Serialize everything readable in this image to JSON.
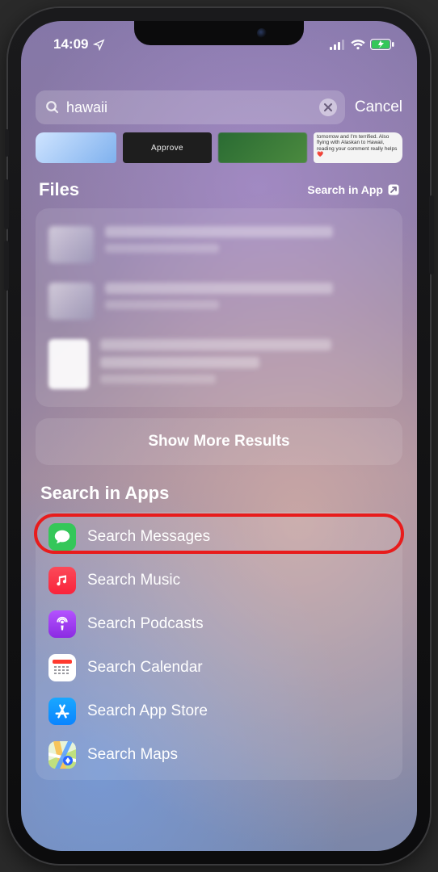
{
  "status": {
    "time": "14:09",
    "location_icon": "location-arrow"
  },
  "search": {
    "query": "hawaii",
    "cancel_label": "Cancel"
  },
  "suggestions": {
    "approve_label": "Approve",
    "snippet": "tomorrow and I'm terrified. Also flying with Alaskan to Hawaii, reading your comment really helps ❤️"
  },
  "files": {
    "title": "Files",
    "search_in_app_label": "Search in App"
  },
  "show_more_label": "Show More Results",
  "apps_section_title": "Search in Apps",
  "apps": [
    {
      "label": "Search Messages",
      "icon": "messages",
      "color": "#34c759"
    },
    {
      "label": "Search Music",
      "icon": "music",
      "color": "linear-gradient(180deg,#fb4a59,#fa233b)"
    },
    {
      "label": "Search Podcasts",
      "icon": "podcasts",
      "color": "linear-gradient(180deg,#b452ff,#8b2be2)"
    },
    {
      "label": "Search Calendar",
      "icon": "calendar",
      "color": "#ffffff"
    },
    {
      "label": "Search App Store",
      "icon": "appstore",
      "color": "linear-gradient(180deg,#19a8ff,#0a84ff)"
    },
    {
      "label": "Search Maps",
      "icon": "maps",
      "color": ""
    }
  ]
}
